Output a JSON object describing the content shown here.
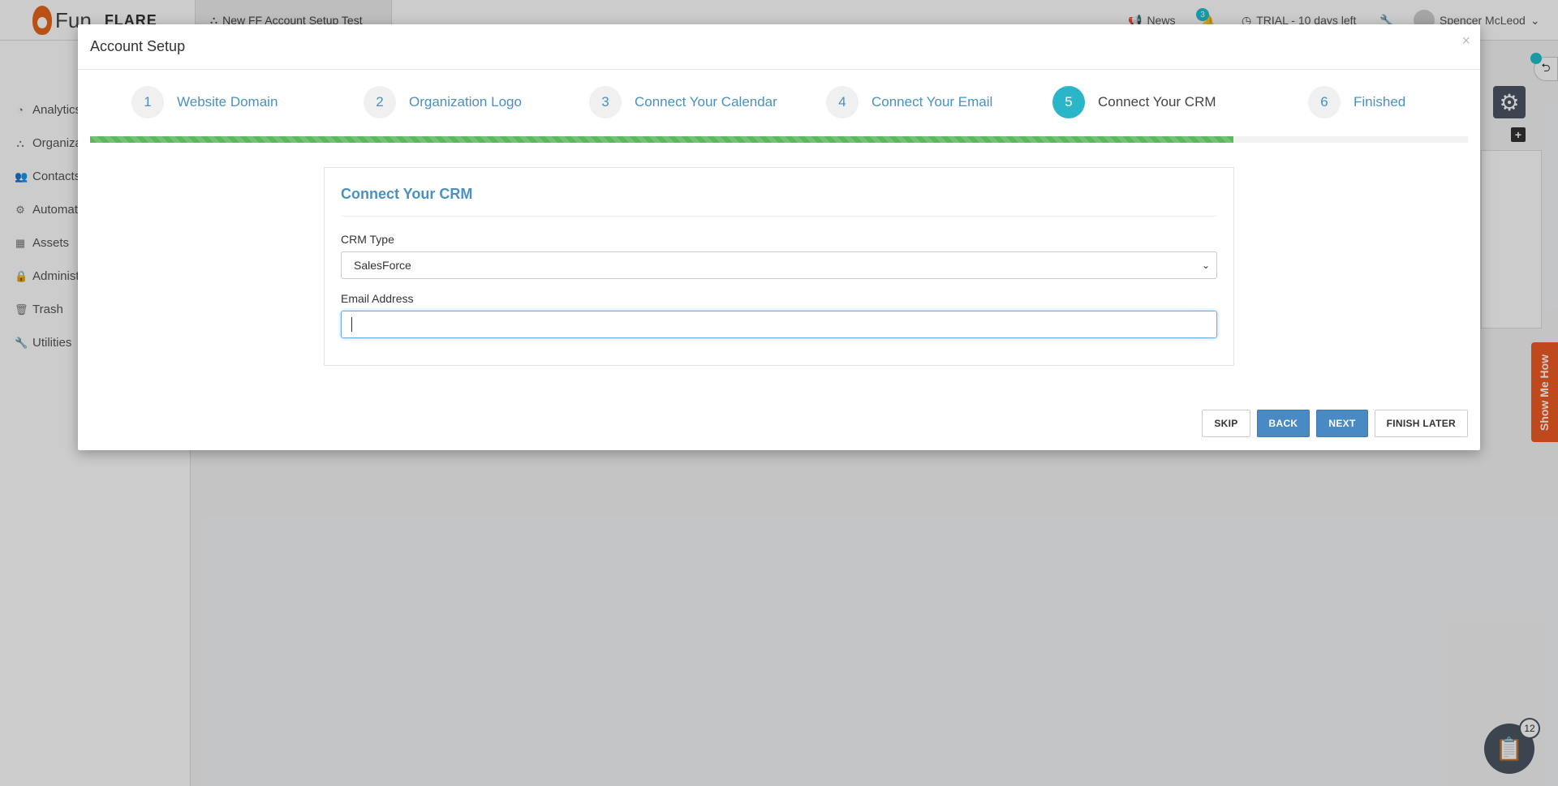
{
  "app": {
    "logo_text": "Fun",
    "logo_brand": "FLARE",
    "open_tab": "New FF Account Setup Test",
    "news_label": "News",
    "notification_count": "3",
    "trial_text": "TRIAL - 10 days left",
    "user_name": "Spencer McLeod"
  },
  "sidebar": {
    "items": [
      {
        "label": "Analytics",
        "icon": "dashboard-icon"
      },
      {
        "label": "Organiza",
        "icon": "sitemap-icon"
      },
      {
        "label": "Contacts",
        "icon": "users-icon"
      },
      {
        "label": "Automat",
        "icon": "cogs-icon"
      },
      {
        "label": "Assets",
        "icon": "grid-icon"
      },
      {
        "label": "Administ",
        "icon": "lock-icon"
      },
      {
        "label": "Trash",
        "icon": "trash-icon"
      },
      {
        "label": "Utilities",
        "icon": "wrench-icon"
      }
    ]
  },
  "floating": {
    "show_me_how": "Show Me How",
    "checklist_count": "12"
  },
  "modal": {
    "title": "Account Setup",
    "close_symbol": "×",
    "steps": [
      {
        "num": "1",
        "label": "Website Domain"
      },
      {
        "num": "2",
        "label": "Organization Logo"
      },
      {
        "num": "3",
        "label": "Connect Your Calendar"
      },
      {
        "num": "4",
        "label": "Connect Your Email"
      },
      {
        "num": "5",
        "label": "Connect Your CRM"
      },
      {
        "num": "6",
        "label": "Finished"
      }
    ],
    "active_step": 5,
    "progress_fraction": 0.83,
    "progress_color": "#5cb85c",
    "card": {
      "title": "Connect Your CRM",
      "crm_type_label": "CRM Type",
      "crm_type_value": "SalesForce",
      "email_label": "Email Address",
      "email_value": ""
    },
    "buttons": {
      "skip": "SKIP",
      "back": "BACK",
      "next": "NEXT",
      "finish_later": "FINISH LATER"
    }
  }
}
